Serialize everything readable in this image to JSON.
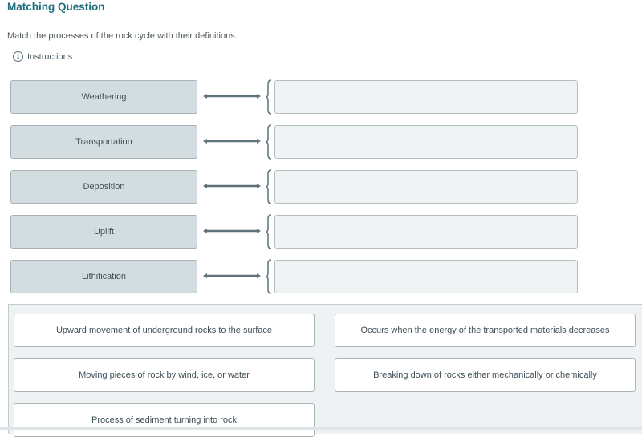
{
  "header": {
    "title": "Matching Question",
    "prompt": "Match the processes of the rock cycle with their definitions.",
    "instructions_label": "Instructions",
    "instructions_icon": "info-circle-icon"
  },
  "terms": [
    {
      "label": "Weathering"
    },
    {
      "label": "Transportation"
    },
    {
      "label": "Deposition"
    },
    {
      "label": "Uplift"
    },
    {
      "label": "Lithification"
    }
  ],
  "drop_zones": [
    {
      "value": ""
    },
    {
      "value": ""
    },
    {
      "value": ""
    },
    {
      "value": ""
    },
    {
      "value": ""
    }
  ],
  "choices": [
    {
      "text": "Upward movement of underground rocks to the surface"
    },
    {
      "text": "Occurs when the energy of the transported materials decreases"
    },
    {
      "text": "Moving pieces of rock by wind, ice, or water"
    },
    {
      "text": "Breaking down of rocks either mechanically or chemically"
    },
    {
      "text": "Process of sediment turning into rock"
    }
  ],
  "colors": {
    "title": "#1f6e7e",
    "term_bg": "#d3dde0",
    "drop_bg": "#eff3f4",
    "arrow": "#5f727a",
    "bank_bg": "#eff2f3"
  }
}
